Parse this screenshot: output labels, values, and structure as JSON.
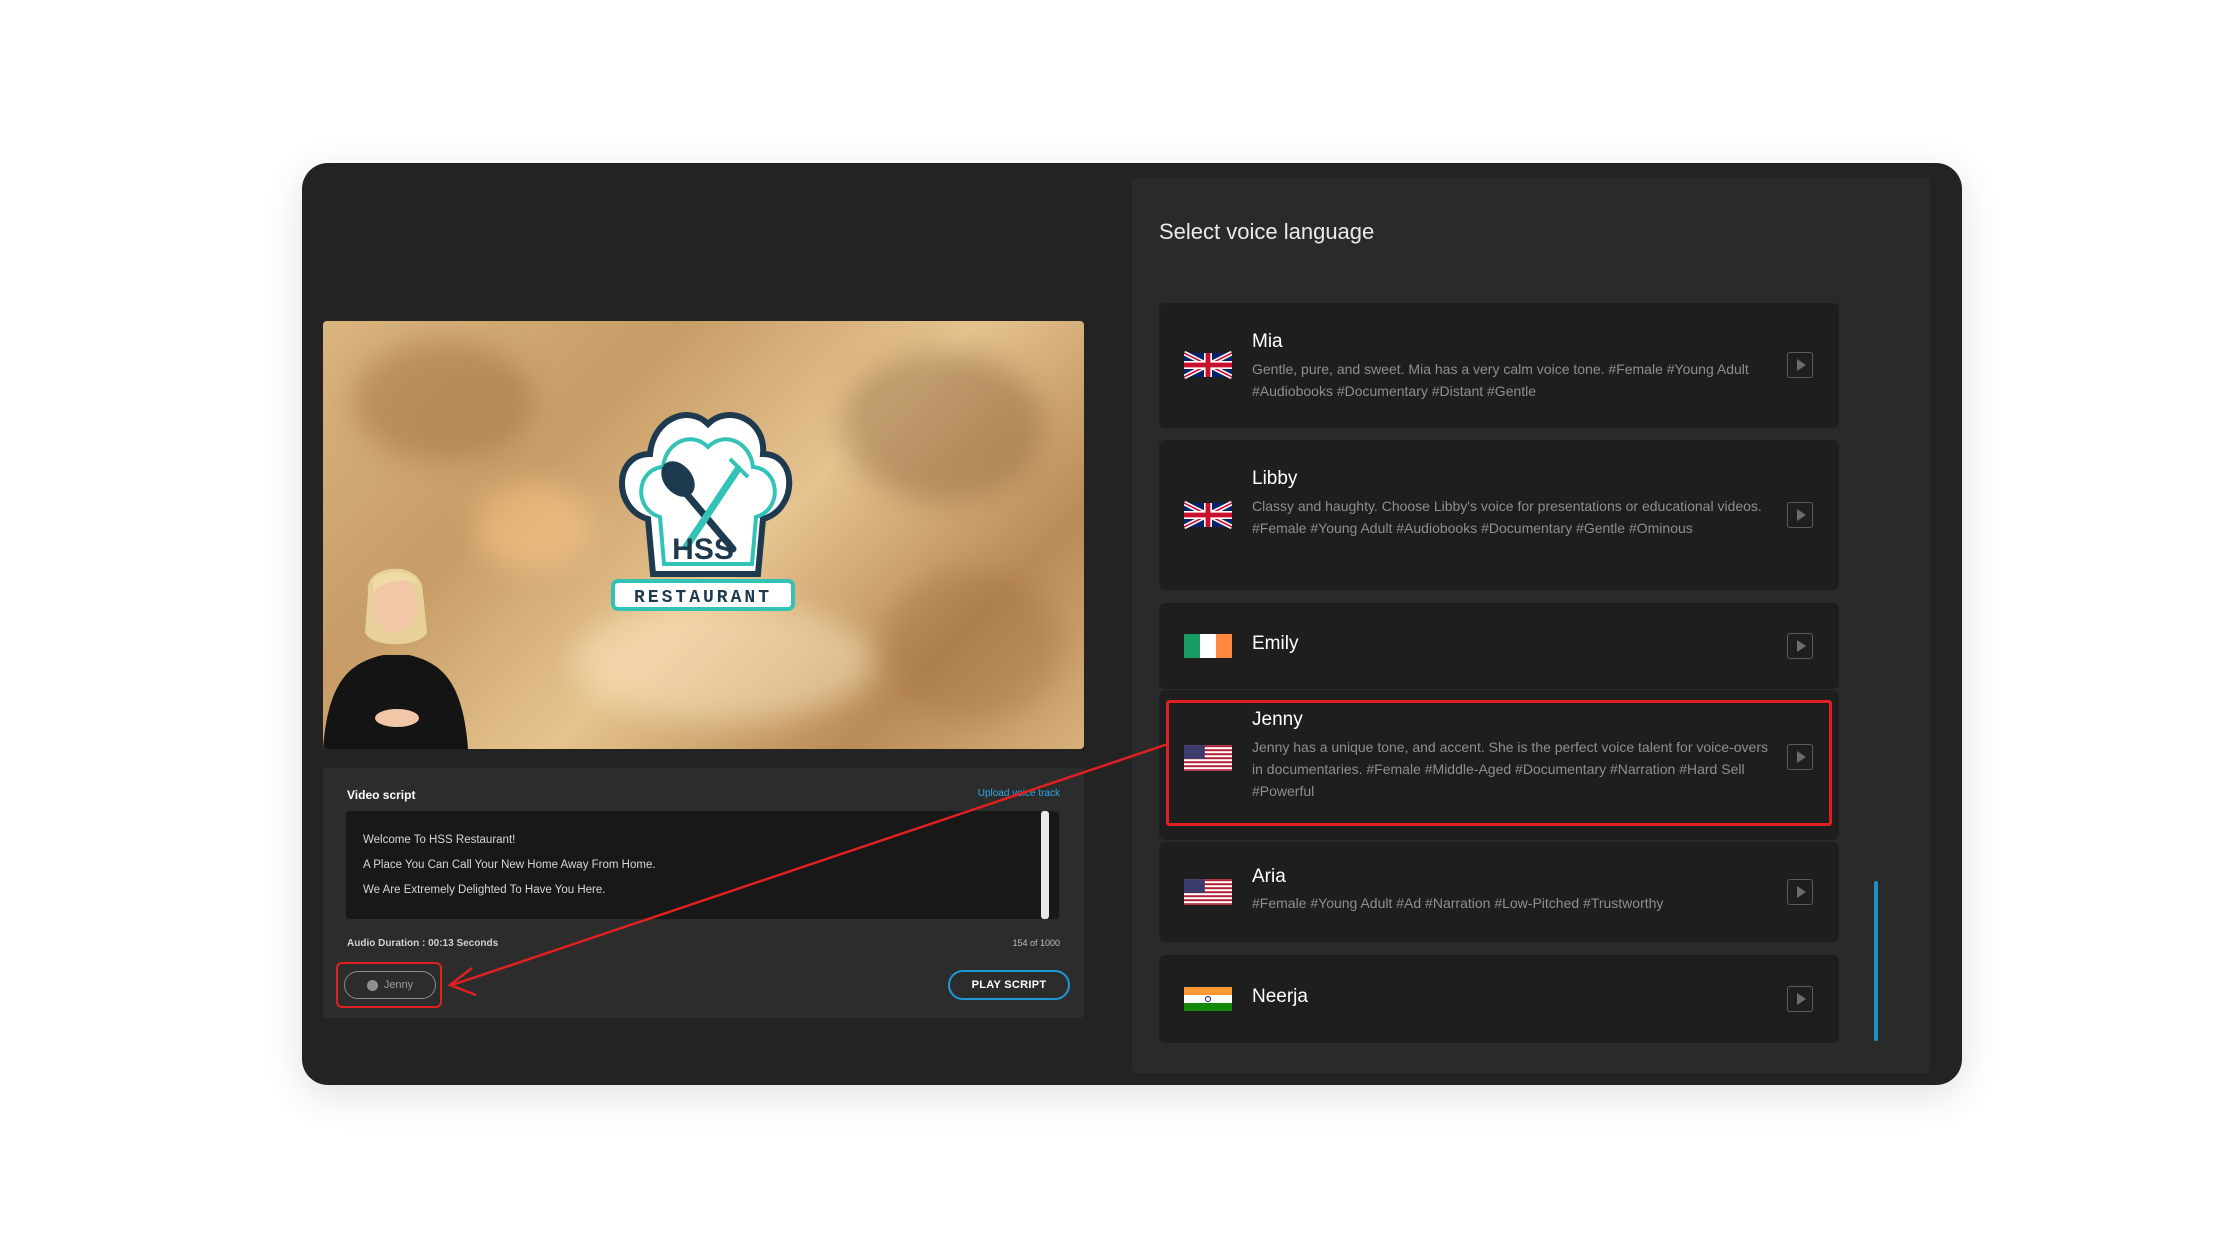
{
  "panel": {
    "title": "Select voice language"
  },
  "voices": [
    {
      "name": "Mia",
      "flag": "uk",
      "description": "Gentle, pure, and sweet. Mia has a very calm voice tone. #Female #Young Adult #Audiobooks #Documentary #Distant #Gentle",
      "play_icon": "play-icon"
    },
    {
      "name": "Libby",
      "flag": "uk",
      "description": "Classy and haughty. Choose Libby's voice for presentations or educational videos. #Female #Young Adult #Audiobooks #Documentary #Gentle #Ominous",
      "play_icon": "play-icon"
    },
    {
      "name": "Emily",
      "flag": "ireland",
      "description": "",
      "play_icon": "play-icon"
    },
    {
      "name": "Jenny",
      "flag": "us",
      "description": "Jenny has a unique tone, and accent. She is the perfect voice talent for voice-overs in documentaries. #Female #Middle-Aged #Documentary #Narration #Hard Sell #Powerful",
      "play_icon": "play-icon",
      "highlighted": true
    },
    {
      "name": "Aria",
      "flag": "us",
      "description": "#Female #Young Adult #Ad #Narration #Low-Pitched #Trustworthy",
      "play_icon": "play-icon"
    },
    {
      "name": "Neerja",
      "flag": "india",
      "description": "",
      "play_icon": "play-icon"
    }
  ],
  "preview": {
    "logo_text": "HSS",
    "logo_banner": "RESTAURANT"
  },
  "script": {
    "label": "Video script",
    "upload_link": "Upload voice track",
    "lines": [
      "Welcome To HSS Restaurant!",
      "A Place You Can Call Your New Home Away From Home.",
      "We Are Extremely Delighted To Have You Here."
    ],
    "duration": "Audio Duration : 00:13 Seconds",
    "char_count": "154 of 1000",
    "voice_button": "Jenny",
    "play_button": "PLAY SCRIPT"
  },
  "colors": {
    "accent": "#1f98d6",
    "highlight": "#e02020",
    "background": "#232323"
  }
}
